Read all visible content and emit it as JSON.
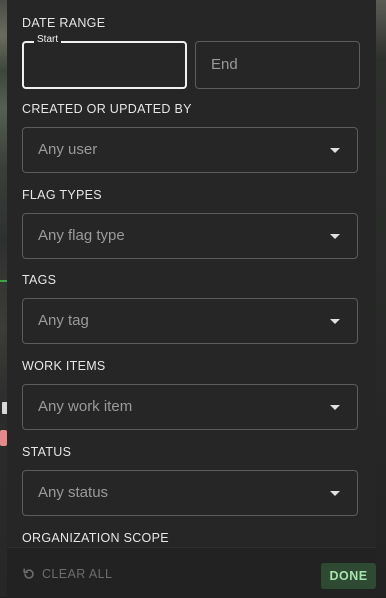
{
  "filters": {
    "date_range": {
      "label": "DATE RANGE",
      "start_label": "Start",
      "start_value": "",
      "end_placeholder": "End"
    },
    "created_by": {
      "label": "CREATED OR UPDATED BY",
      "placeholder": "Any user"
    },
    "flag_types": {
      "label": "FLAG TYPES",
      "placeholder": "Any flag type"
    },
    "tags": {
      "label": "TAGS",
      "placeholder": "Any tag"
    },
    "work_items": {
      "label": "WORK ITEMS",
      "placeholder": "Any work item"
    },
    "status": {
      "label": "STATUS",
      "placeholder": "Any status"
    },
    "org_scope": {
      "label": "ORGANIZATION SCOPE"
    }
  },
  "footer": {
    "clear_all_label": "CLEAR ALL",
    "done_label": "DONE"
  },
  "icons": {
    "clear": "reset-icon",
    "dropdown": "caret-down-icon"
  },
  "colors": {
    "panel_bg": "#262626",
    "done_bg": "#2e4a33",
    "done_text": "#a7e3ae"
  }
}
